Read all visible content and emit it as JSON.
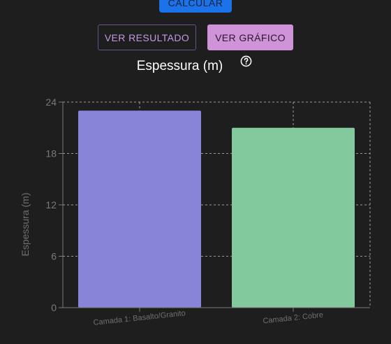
{
  "buttons": {
    "calculate_label": "CALCULAR",
    "result_label": "VER RESULTADO",
    "chart_label": "VER GRÁFICO"
  },
  "icons": {
    "help": "help-circle-icon"
  },
  "colors": {
    "background": "#1e1e1e",
    "calculate": "#1a73e8",
    "chart_button": "#cf94d8",
    "result_border": "#6c4f8d",
    "bar_1": "#8884d8",
    "bar_2": "#82ca9d",
    "grid": "#9e9e9e",
    "axis_text": "#7a7a7a"
  },
  "chart_data": {
    "type": "bar",
    "title": "Espessura (m)",
    "xlabel": "",
    "ylabel": "Espessura (m)",
    "categories": [
      "Camada 1: Basalto/Granito",
      "Camada 2: Cobre"
    ],
    "values": [
      23,
      21
    ],
    "ylim": [
      0,
      24
    ],
    "yticks": [
      0,
      6,
      12,
      18,
      24
    ],
    "grid": true,
    "legend": "none"
  }
}
